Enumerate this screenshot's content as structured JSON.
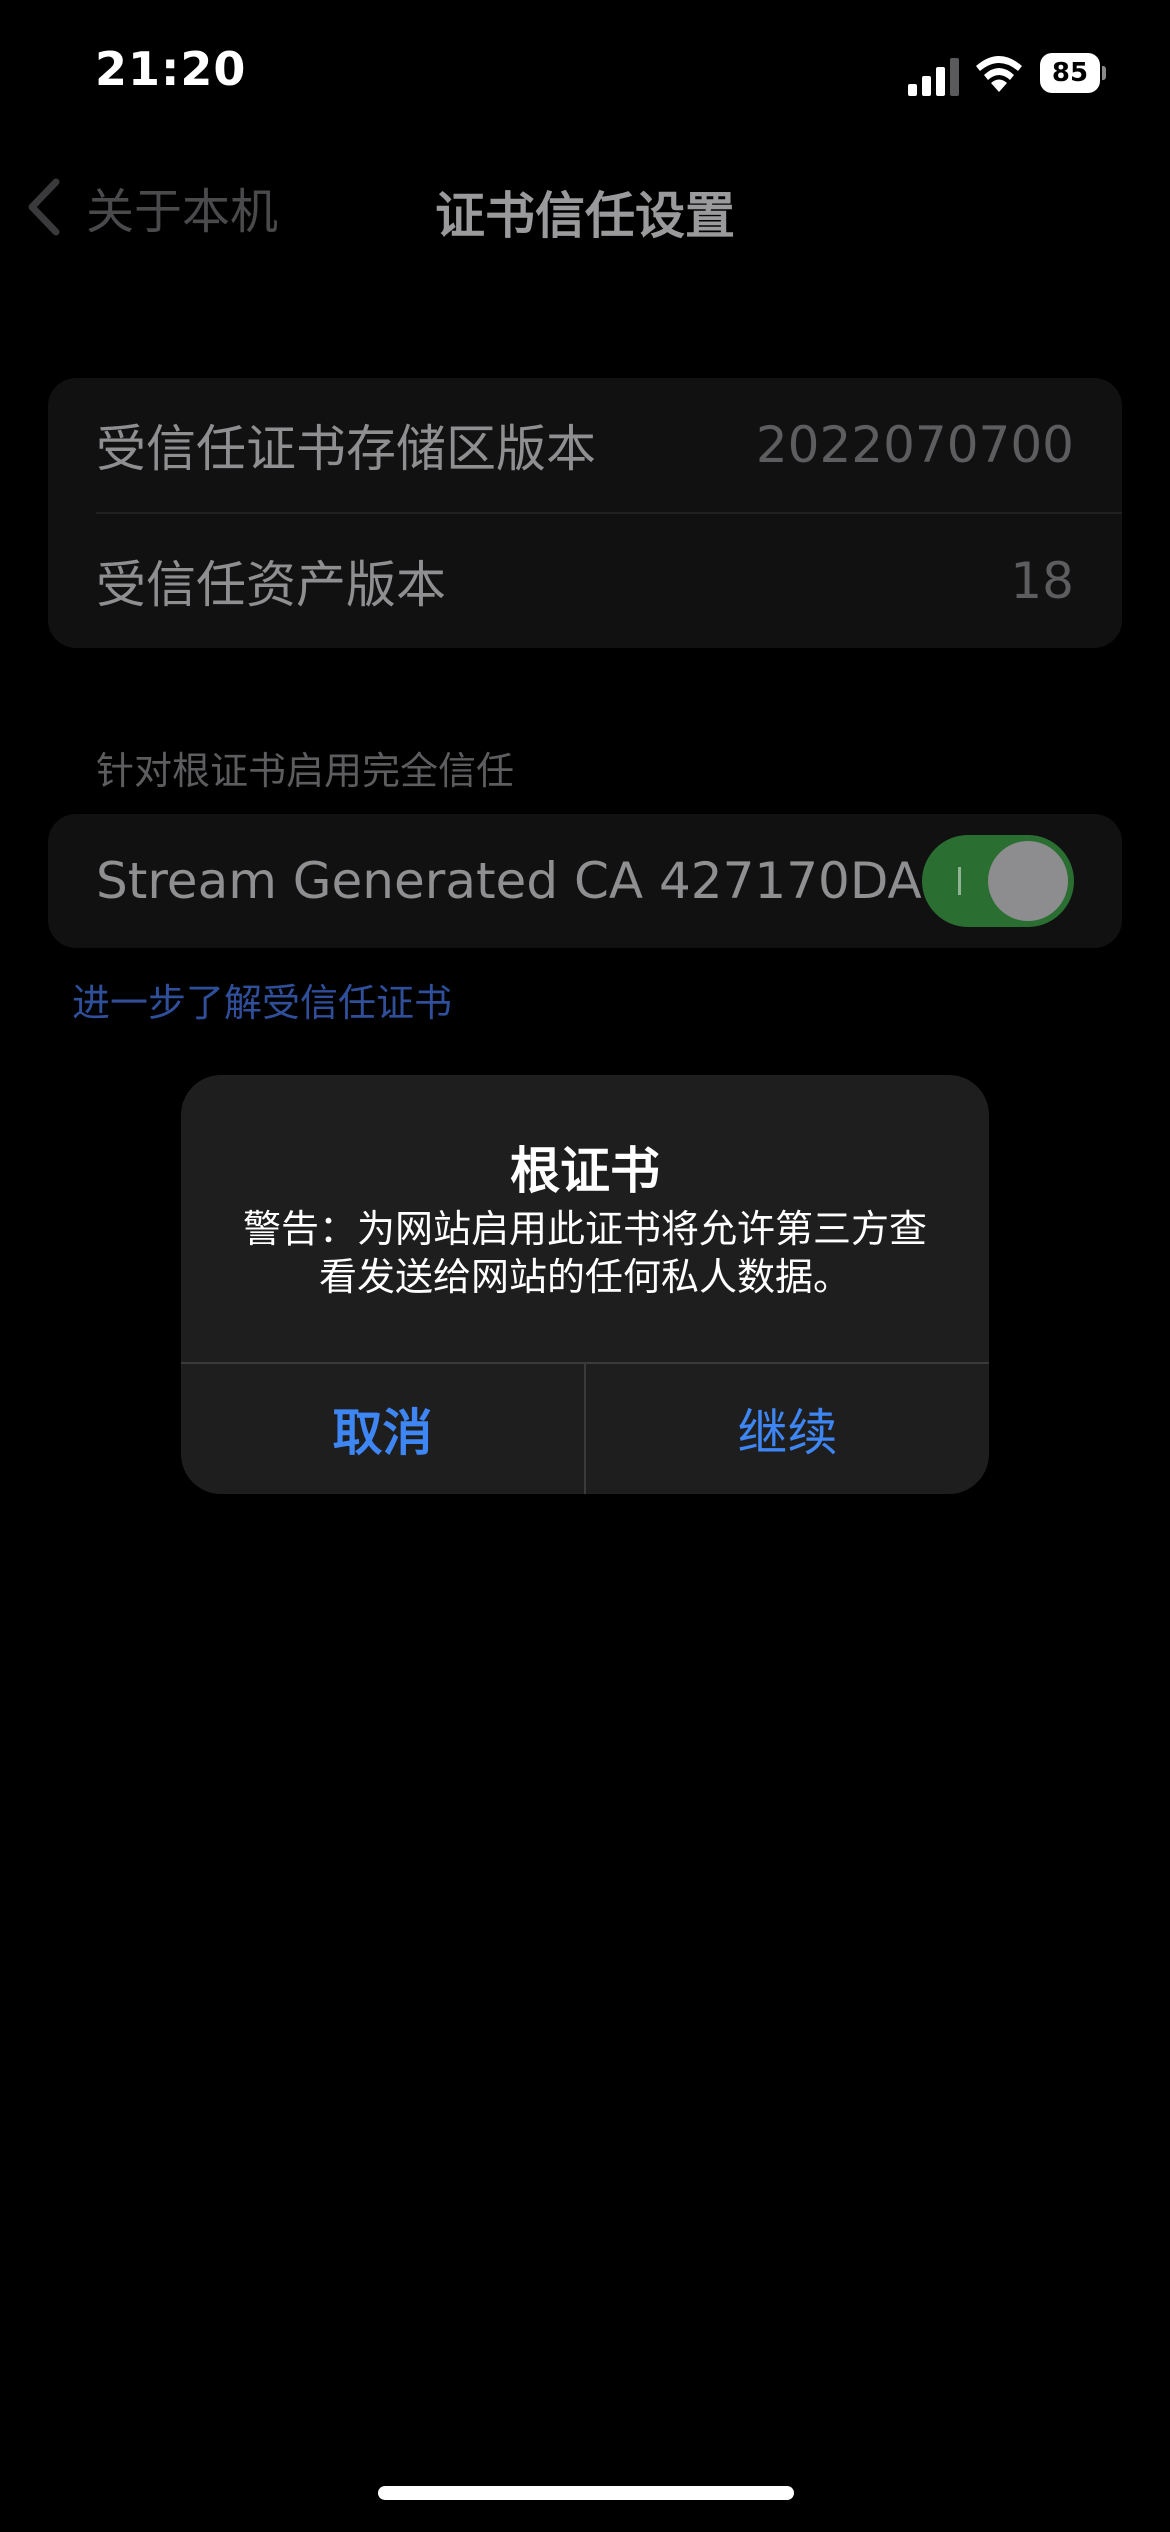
{
  "status_bar": {
    "time": "21:20",
    "battery": "85"
  },
  "nav": {
    "back_label": "关于本机",
    "title": "证书信任设置"
  },
  "info_group": {
    "rows": [
      {
        "label": "受信任证书存储区版本",
        "value": "2022070700"
      },
      {
        "label": "受信任资产版本",
        "value": "18"
      }
    ]
  },
  "trust_section": {
    "header": "针对根证书启用完全信任",
    "certificate_name": "Stream Generated CA 427170DA",
    "toggle_on": true,
    "learn_more": "进一步了解受信任证书"
  },
  "alert": {
    "title": "根证书",
    "message": "警告：为网站启用此证书将允许第三方查看发送给网站的任何私人数据。",
    "cancel_label": "取消",
    "continue_label": "继续"
  },
  "colors": {
    "accent_blue": "#3f86f5",
    "toggle_green": "#2b6e31"
  }
}
